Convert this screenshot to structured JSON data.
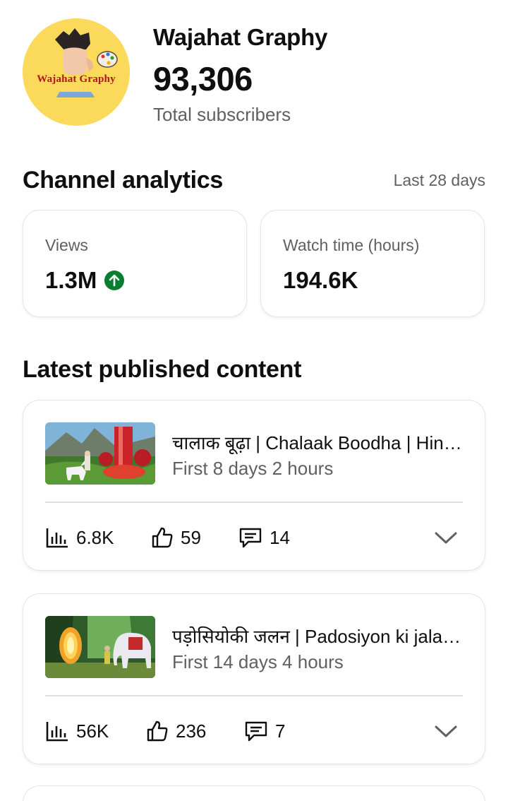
{
  "channel": {
    "name": "Wajahat Graphy",
    "subscribers": "93,306",
    "subscribers_label": "Total subscribers",
    "avatar_text": "Wajahat Graphy",
    "avatar_bg": "#fbd95a"
  },
  "analytics": {
    "title": "Channel analytics",
    "range": "Last 28 days",
    "cards": [
      {
        "label": "Views",
        "value": "1.3M",
        "trend": "up",
        "trend_color": "#0a7d30"
      },
      {
        "label": "Watch time (hours)",
        "value": "194.6K"
      }
    ]
  },
  "latest": {
    "title": "Latest published content",
    "items": [
      {
        "title": "चालाक बूढ़ा | Chalaak Boodha | Hindi Kahani | Moral Story",
        "age": "First 8 days 2 hours",
        "views": "6.8K",
        "likes": "59",
        "comments": "14",
        "thumbnail_icon": "waterfall-unicorn-thumbnail"
      },
      {
        "title": "पड़ोसियोकी जलन | Padosiyon ki jalan | Hindi Kahani",
        "age": "First 14 days 4 hours",
        "views": "56K",
        "likes": "236",
        "comments": "7",
        "thumbnail_icon": "portal-elephant-thumbnail"
      }
    ]
  },
  "icons": {
    "views": "bar-chart-icon",
    "likes": "thumbs-up-icon",
    "comments": "comment-icon",
    "expand": "chevron-down-icon",
    "trend": "arrow-up-circle-icon"
  }
}
